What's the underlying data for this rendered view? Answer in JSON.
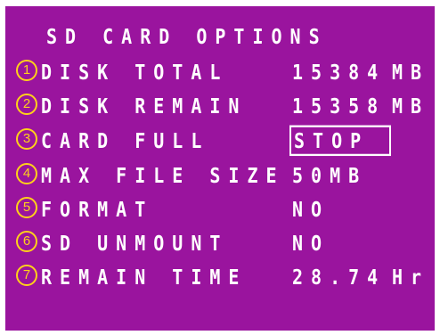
{
  "menu": {
    "title": "SD CARD OPTIONS",
    "items": [
      {
        "number": "1",
        "label": "DISK TOTAL",
        "value": "15384",
        "unit": "MB",
        "selected": false
      },
      {
        "number": "2",
        "label": "DISK REMAIN",
        "value": "15358",
        "unit": "MB",
        "selected": false
      },
      {
        "number": "3",
        "label": "CARD FULL",
        "value": "STOP",
        "unit": "",
        "selected": true
      },
      {
        "number": "4",
        "label": "MAX FILE SIZE",
        "value": "50MB",
        "unit": "",
        "selected": false
      },
      {
        "number": "5",
        "label": "FORMAT",
        "value": "NO",
        "unit": "",
        "selected": false
      },
      {
        "number": "6",
        "label": "SD UNMOUNT",
        "value": "NO",
        "unit": "",
        "selected": false
      },
      {
        "number": "7",
        "label": "REMAIN TIME",
        "value": "28.74",
        "unit": "Hr",
        "selected": false
      }
    ]
  },
  "colors": {
    "background": "#9a149e",
    "text": "#ffffff",
    "number_badge": "#ffd11a"
  }
}
